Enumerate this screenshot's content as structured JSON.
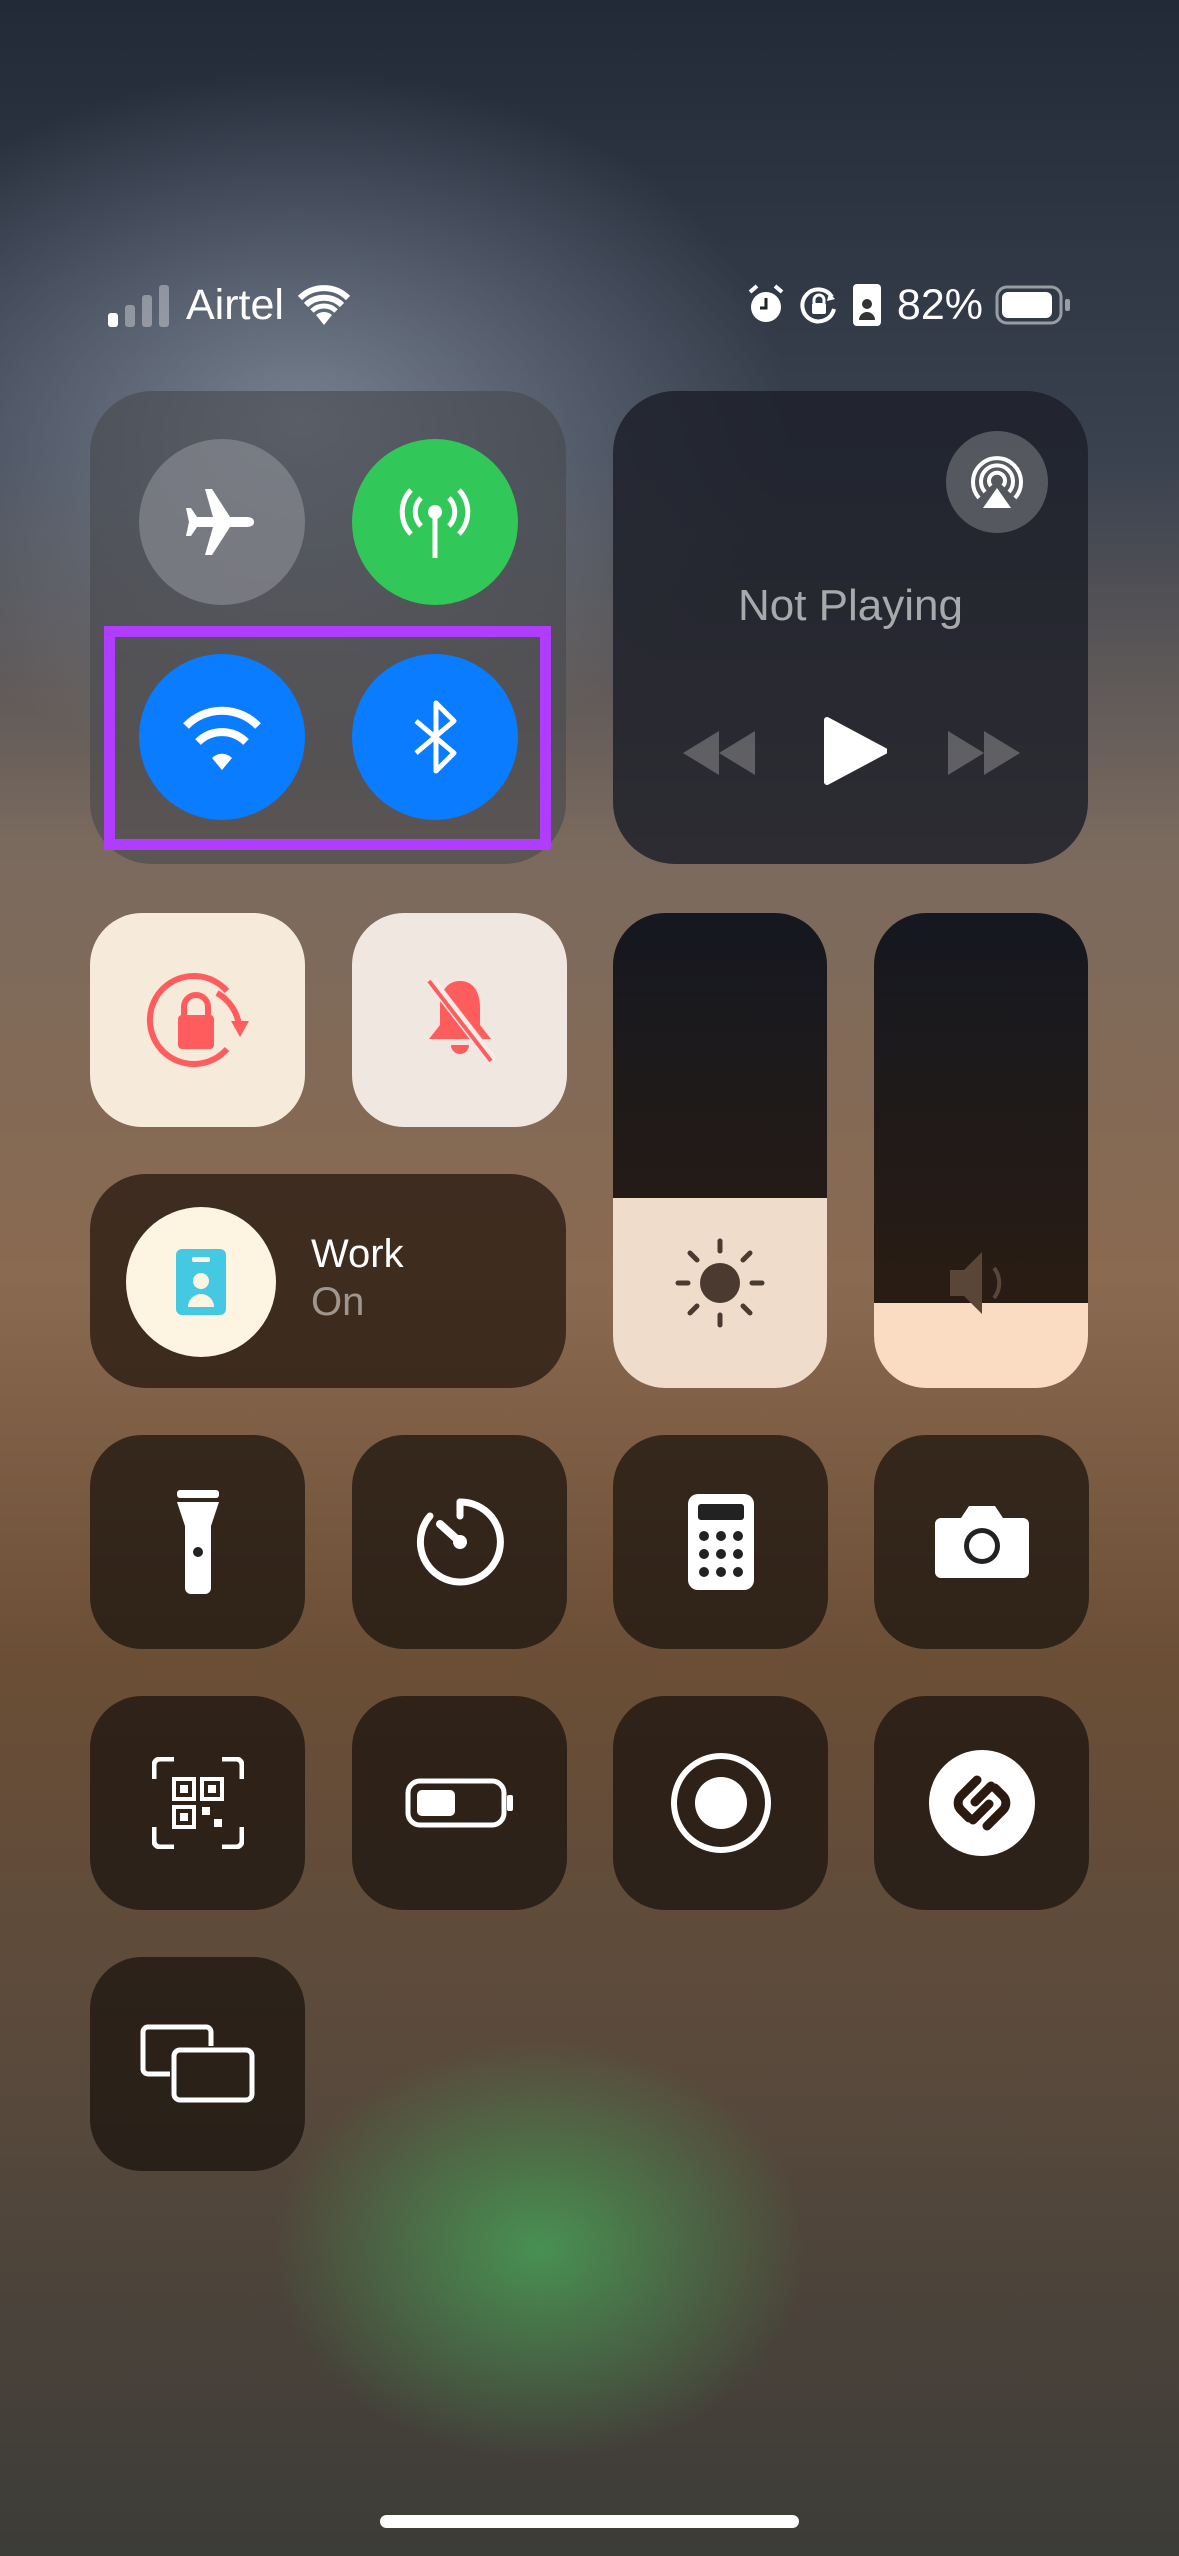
{
  "status_bar": {
    "carrier": "Airtel",
    "battery_percent": "82%",
    "signal_bars": 1,
    "icons": [
      "signal-icon",
      "wifi-icon",
      "alarm-icon",
      "rotation-lock-icon",
      "focus-work-icon",
      "battery-icon"
    ]
  },
  "connectivity": {
    "airplane_mode": false,
    "cellular_data": true,
    "wifi": true,
    "bluetooth": true,
    "highlight_color": "#b03cff",
    "active_blue": "#0a7cff",
    "active_green": "#32c759"
  },
  "now_playing": {
    "title": "Not Playing"
  },
  "focus": {
    "name": "Work",
    "state": "On"
  },
  "brightness_level": 0.4,
  "volume_level": 0.18,
  "tiles": [
    "rotation-lock",
    "silent-mode",
    "flashlight",
    "timer",
    "calculator",
    "camera",
    "qr-scanner",
    "low-power-mode",
    "screen-recording",
    "shazam",
    "screen-mirroring"
  ]
}
